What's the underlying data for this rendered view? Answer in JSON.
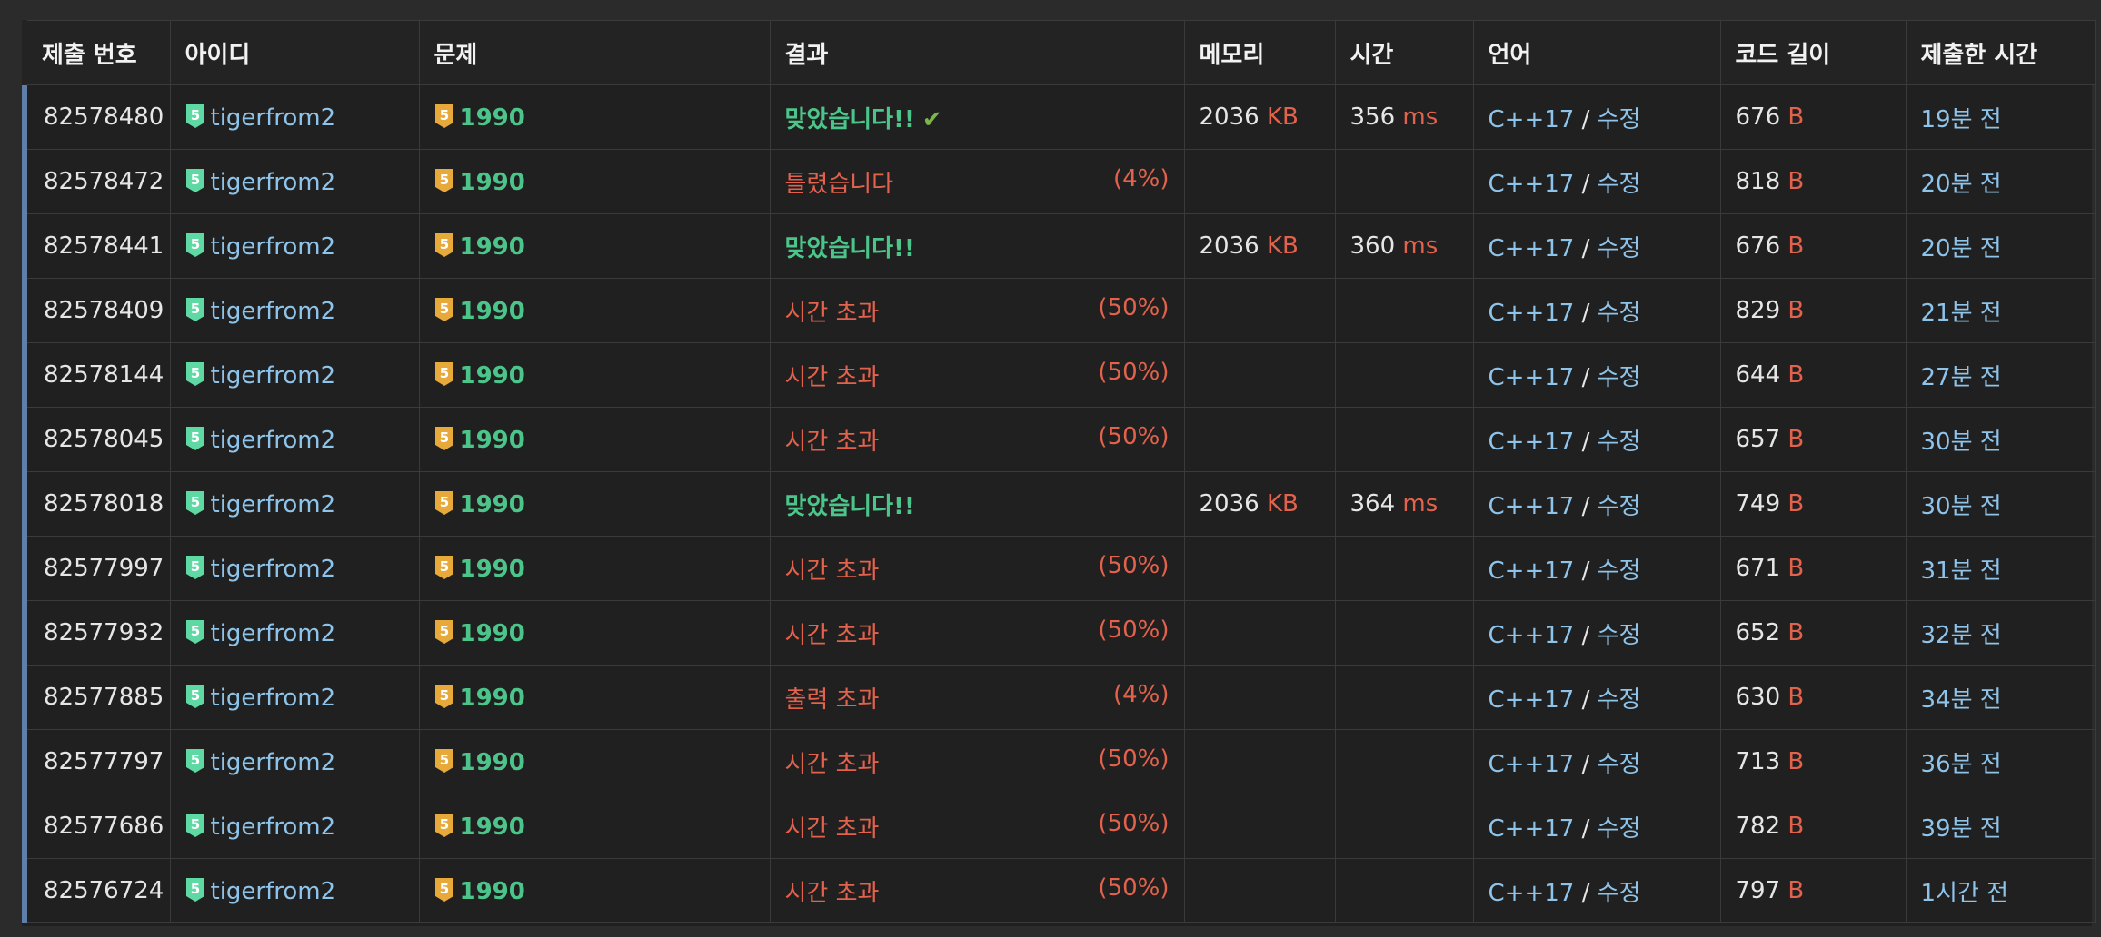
{
  "headers": [
    "제출 번호",
    "아이디",
    "문제",
    "결과",
    "메모리",
    "시간",
    "언어",
    "코드 길이",
    "제출한 시간"
  ],
  "colors": {
    "accepted": "#4cc58a",
    "error": "#e3624c",
    "link": "#8ec3ea",
    "tier_user": "#5fd9a4",
    "tier_problem": "#e8a93b"
  },
  "icons": {
    "user_tier": "tier-5-badge-icon",
    "problem_tier": "tier-5-badge-icon",
    "accepted_mark": "check-icon"
  },
  "rows": [
    {
      "id": "82578480",
      "user": "tigerfrom2",
      "user_tier": "5",
      "problem": "1990",
      "problem_tier": "5",
      "result": "맞았습니다!!",
      "ok": true,
      "check": "✔",
      "pct": "",
      "memory": "2036",
      "memory_unit": "KB",
      "time": "356",
      "time_unit": "ms",
      "lang": "C++17",
      "edit": "수정",
      "code_len": "676",
      "code_unit": "B",
      "submitted": "19분 전"
    },
    {
      "id": "82578472",
      "user": "tigerfrom2",
      "user_tier": "5",
      "problem": "1990",
      "problem_tier": "5",
      "result": "틀렸습니다",
      "ok": false,
      "check": "",
      "pct": "(4%)",
      "memory": "",
      "memory_unit": "",
      "time": "",
      "time_unit": "",
      "lang": "C++17",
      "edit": "수정",
      "code_len": "818",
      "code_unit": "B",
      "submitted": "20분 전"
    },
    {
      "id": "82578441",
      "user": "tigerfrom2",
      "user_tier": "5",
      "problem": "1990",
      "problem_tier": "5",
      "result": "맞았습니다!!",
      "ok": true,
      "check": "",
      "pct": "",
      "memory": "2036",
      "memory_unit": "KB",
      "time": "360",
      "time_unit": "ms",
      "lang": "C++17",
      "edit": "수정",
      "code_len": "676",
      "code_unit": "B",
      "submitted": "20분 전"
    },
    {
      "id": "82578409",
      "user": "tigerfrom2",
      "user_tier": "5",
      "problem": "1990",
      "problem_tier": "5",
      "result": "시간 초과",
      "ok": false,
      "check": "",
      "pct": "(50%)",
      "memory": "",
      "memory_unit": "",
      "time": "",
      "time_unit": "",
      "lang": "C++17",
      "edit": "수정",
      "code_len": "829",
      "code_unit": "B",
      "submitted": "21분 전"
    },
    {
      "id": "82578144",
      "user": "tigerfrom2",
      "user_tier": "5",
      "problem": "1990",
      "problem_tier": "5",
      "result": "시간 초과",
      "ok": false,
      "check": "",
      "pct": "(50%)",
      "memory": "",
      "memory_unit": "",
      "time": "",
      "time_unit": "",
      "lang": "C++17",
      "edit": "수정",
      "code_len": "644",
      "code_unit": "B",
      "submitted": "27분 전"
    },
    {
      "id": "82578045",
      "user": "tigerfrom2",
      "user_tier": "5",
      "problem": "1990",
      "problem_tier": "5",
      "result": "시간 초과",
      "ok": false,
      "check": "",
      "pct": "(50%)",
      "memory": "",
      "memory_unit": "",
      "time": "",
      "time_unit": "",
      "lang": "C++17",
      "edit": "수정",
      "code_len": "657",
      "code_unit": "B",
      "submitted": "30분 전"
    },
    {
      "id": "82578018",
      "user": "tigerfrom2",
      "user_tier": "5",
      "problem": "1990",
      "problem_tier": "5",
      "result": "맞았습니다!!",
      "ok": true,
      "check": "",
      "pct": "",
      "memory": "2036",
      "memory_unit": "KB",
      "time": "364",
      "time_unit": "ms",
      "lang": "C++17",
      "edit": "수정",
      "code_len": "749",
      "code_unit": "B",
      "submitted": "30분 전"
    },
    {
      "id": "82577997",
      "user": "tigerfrom2",
      "user_tier": "5",
      "problem": "1990",
      "problem_tier": "5",
      "result": "시간 초과",
      "ok": false,
      "check": "",
      "pct": "(50%)",
      "memory": "",
      "memory_unit": "",
      "time": "",
      "time_unit": "",
      "lang": "C++17",
      "edit": "수정",
      "code_len": "671",
      "code_unit": "B",
      "submitted": "31분 전"
    },
    {
      "id": "82577932",
      "user": "tigerfrom2",
      "user_tier": "5",
      "problem": "1990",
      "problem_tier": "5",
      "result": "시간 초과",
      "ok": false,
      "check": "",
      "pct": "(50%)",
      "memory": "",
      "memory_unit": "",
      "time": "",
      "time_unit": "",
      "lang": "C++17",
      "edit": "수정",
      "code_len": "652",
      "code_unit": "B",
      "submitted": "32분 전"
    },
    {
      "id": "82577885",
      "user": "tigerfrom2",
      "user_tier": "5",
      "problem": "1990",
      "problem_tier": "5",
      "result": "출력 초과",
      "ok": false,
      "check": "",
      "pct": "(4%)",
      "memory": "",
      "memory_unit": "",
      "time": "",
      "time_unit": "",
      "lang": "C++17",
      "edit": "수정",
      "code_len": "630",
      "code_unit": "B",
      "submitted": "34분 전"
    },
    {
      "id": "82577797",
      "user": "tigerfrom2",
      "user_tier": "5",
      "problem": "1990",
      "problem_tier": "5",
      "result": "시간 초과",
      "ok": false,
      "check": "",
      "pct": "(50%)",
      "memory": "",
      "memory_unit": "",
      "time": "",
      "time_unit": "",
      "lang": "C++17",
      "edit": "수정",
      "code_len": "713",
      "code_unit": "B",
      "submitted": "36분 전"
    },
    {
      "id": "82577686",
      "user": "tigerfrom2",
      "user_tier": "5",
      "problem": "1990",
      "problem_tier": "5",
      "result": "시간 초과",
      "ok": false,
      "check": "",
      "pct": "(50%)",
      "memory": "",
      "memory_unit": "",
      "time": "",
      "time_unit": "",
      "lang": "C++17",
      "edit": "수정",
      "code_len": "782",
      "code_unit": "B",
      "submitted": "39분 전"
    },
    {
      "id": "82576724",
      "user": "tigerfrom2",
      "user_tier": "5",
      "problem": "1990",
      "problem_tier": "5",
      "result": "시간 초과",
      "ok": false,
      "check": "",
      "pct": "(50%)",
      "memory": "",
      "memory_unit": "",
      "time": "",
      "time_unit": "",
      "lang": "C++17",
      "edit": "수정",
      "code_len": "797",
      "code_unit": "B",
      "submitted": "1시간 전"
    }
  ]
}
